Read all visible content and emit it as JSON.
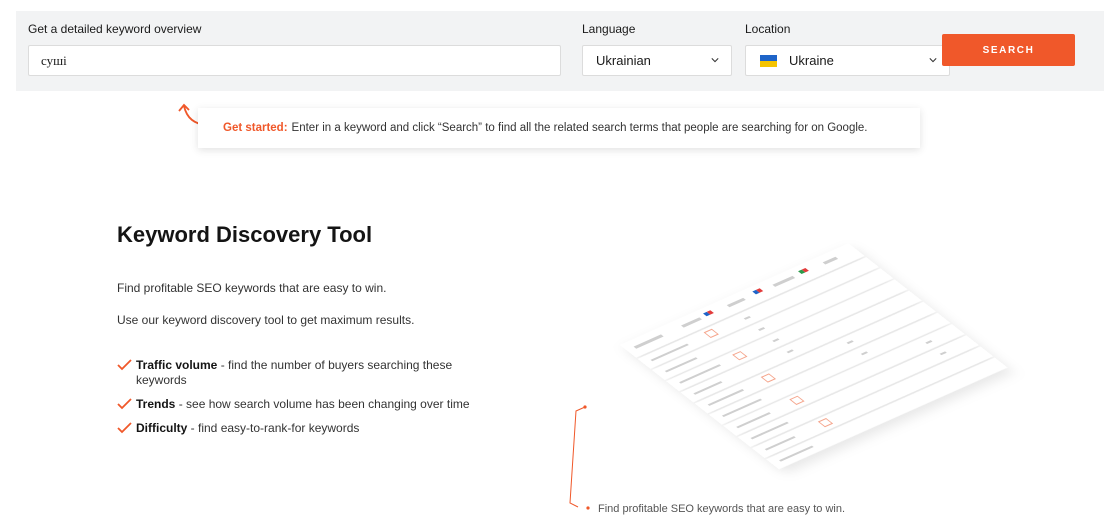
{
  "search": {
    "keyword_label": "Get a detailed keyword overview",
    "keyword_value": "суші",
    "language_label": "Language",
    "language_value": "Ukrainian",
    "location_label": "Location",
    "location_value": "Ukraine",
    "button_label": "SEARCH"
  },
  "hint": {
    "prefix": "Get started:",
    "text": "Enter in a keyword and click “Search” to find all the related search terms that people are searching for on Google."
  },
  "intro": {
    "title": "Keyword Discovery Tool",
    "paragraph_1": "Find profitable SEO keywords that are easy to win.",
    "paragraph_2": "Use our keyword discovery tool to get maximum results."
  },
  "features": [
    {
      "name": "Traffic volume",
      "description": " - find the number of buyers searching these keywords"
    },
    {
      "name": "Trends",
      "description": " - see how search volume has been changing over time"
    },
    {
      "name": "Difficulty",
      "description": " - find easy-to-rank-for keywords"
    }
  ],
  "illustration": {
    "caption": "Find profitable SEO keywords that are easy to win."
  },
  "colors": {
    "accent": "#f0582a",
    "panel_background": "#f2f3f4",
    "flag_blue": "#1e64c8",
    "flag_yellow": "#f5c400"
  },
  "icons": [
    "chevron-down-icon",
    "ukraine-flag-icon",
    "curved-arrow-icon",
    "checkmark-icon"
  ]
}
